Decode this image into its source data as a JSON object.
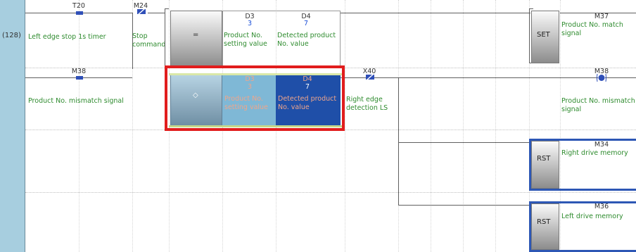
{
  "step_number": "(128)",
  "rungs": {
    "rung1": {
      "t20": {
        "device": "T20",
        "comment": "Left edge stop 1s timer"
      },
      "m24": {
        "device": "M24",
        "comment_line1": "Stop",
        "comment_line2": "command"
      },
      "compare_eq": {
        "operator": "=",
        "op1_device": "D3",
        "op1_value": "3",
        "op1_comment_line1": "Product No.",
        "op1_comment_line2": "setting value",
        "op2_device": "D4",
        "op2_value": "7",
        "op2_comment_line1": "Detected product",
        "op2_comment_line2": "No. value"
      },
      "set_coil": {
        "instruction": "SET",
        "device": "M37",
        "comment_line1": "Product No. match",
        "comment_line2": "signal"
      }
    },
    "rung2": {
      "m38_contact": {
        "device": "M38",
        "comment": "Product No. mismatch signal"
      },
      "compare_ne": {
        "operator": "◇",
        "op1_device": "D3",
        "op1_value": "3",
        "op1_comment_line1": "Product No.",
        "op1_comment_line2": "setting value",
        "op2_device": "D4",
        "op2_value": "7",
        "op2_comment_line1": "Detected product",
        "op2_comment_line2": "No. value"
      },
      "x40": {
        "device": "X40",
        "comment_line1": "Right edge",
        "comment_line2": "detection LS"
      },
      "m38_coil": {
        "device": "M38",
        "comment_line1": "Product No. mismatch",
        "comment_line2": "signal"
      }
    },
    "rung3": {
      "rst_coil": {
        "instruction": "RST",
        "device": "M34",
        "comment": "Right drive memory"
      }
    },
    "rung4": {
      "rst_coil": {
        "instruction": "RST",
        "device": "M36",
        "comment": "Left drive memory"
      }
    }
  },
  "colors": {
    "rail": "#a7cedf",
    "highlight_border": "#e11d1d",
    "selected_cell": "#1f4fa8",
    "compare_cell_bg": "#7fb8d6",
    "contact_blue": "#2f4fb8",
    "comment_green": "#2e8b2e"
  }
}
